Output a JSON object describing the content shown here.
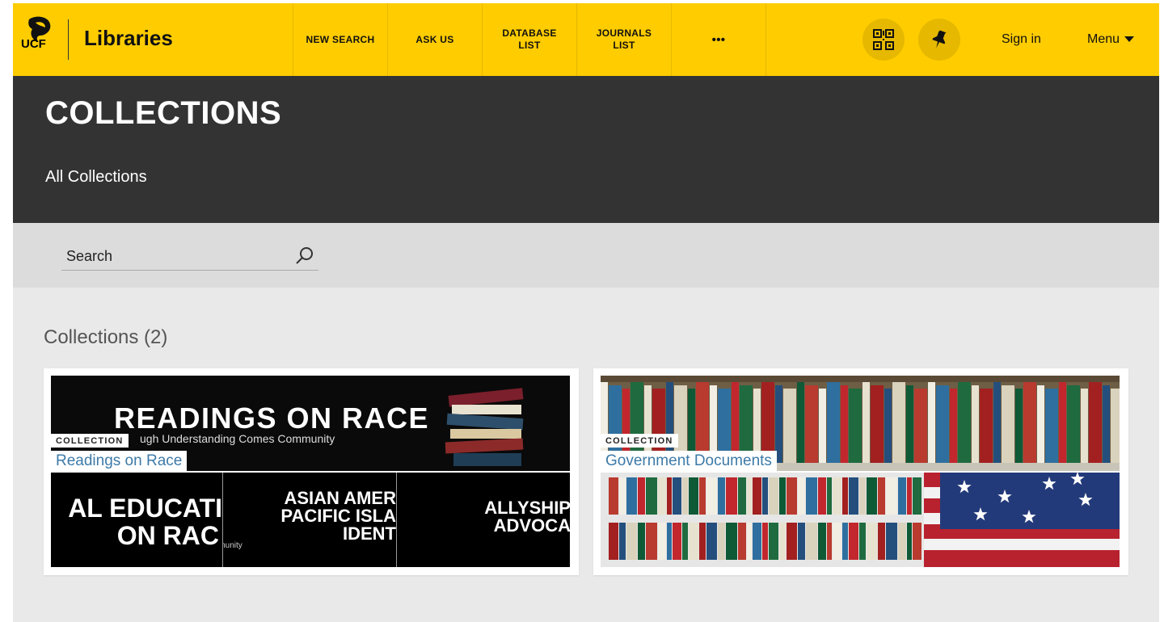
{
  "header": {
    "logo_text": "UCF",
    "brand": "Libraries",
    "nav": [
      {
        "line1": "NEW SEARCH",
        "line2": ""
      },
      {
        "line1": "ASK US",
        "line2": ""
      },
      {
        "line1": "DATABASE",
        "line2": "LIST"
      },
      {
        "line1": "JOURNALS",
        "line2": "LIST"
      },
      {
        "line1": "•••",
        "line2": ""
      }
    ],
    "sign_in": "Sign in",
    "menu": "Menu"
  },
  "hero": {
    "title": "COLLECTIONS",
    "breadcrumb": "All Collections"
  },
  "search": {
    "placeholder": "Search"
  },
  "collections": {
    "heading": "Collections (2)",
    "items": [
      {
        "badge": "COLLECTION",
        "title": "Readings on Race",
        "banner_title": "READINGS ON RACE",
        "banner_sub": "ugh Understanding Comes Community",
        "tiles": [
          {
            "l1": "AL EDUCATI",
            "l2": "ON RAC",
            "extra": "mmunity"
          },
          {
            "l1": "ASIAN AMER",
            "l2": "PACIFIC ISLA",
            "l3": "IDENT"
          },
          {
            "l1": "ALLYSHIP",
            "l2": "ADVOCA"
          }
        ]
      },
      {
        "badge": "COLLECTION",
        "title": "Government Documents"
      }
    ]
  },
  "colors": {
    "accent_yellow": "#ffcc00",
    "hero_dark": "#333333",
    "link_blue": "#3d7aa8"
  }
}
